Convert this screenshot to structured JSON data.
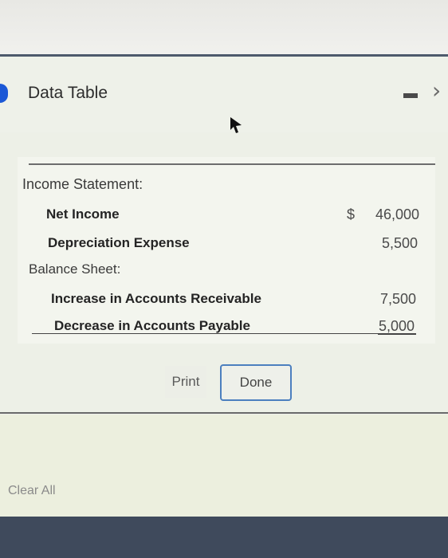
{
  "window": {
    "title": "Data Table"
  },
  "table": {
    "income_statement": {
      "label": "Income Statement:",
      "rows": [
        {
          "label": "Net Income",
          "currency": "$",
          "amount": "46,000"
        },
        {
          "label": "Depreciation Expense",
          "amount": "5,500"
        }
      ]
    },
    "balance_sheet": {
      "label": "Balance Sheet:",
      "rows": [
        {
          "label": "Increase in Accounts Receivable",
          "amount": "7,500"
        },
        {
          "label": "Decrease in Accounts Payable",
          "amount": "5,000"
        }
      ]
    }
  },
  "buttons": {
    "print": "Print",
    "done": "Done",
    "clear_all": "Clear All"
  },
  "icons": {
    "minimize": "minimize-icon",
    "close_chevron": "chevron-right-icon",
    "cursor": "mouse-pointer-icon",
    "indicator": "blue-dot-icon"
  },
  "colors": {
    "accent": "#1b58d6",
    "done_border": "#4c7fbf"
  }
}
